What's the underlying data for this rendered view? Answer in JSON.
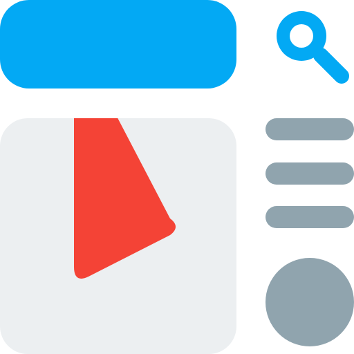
{
  "colors": {
    "accent_blue": "#03A9F4",
    "panel_bg": "#ECEFF1",
    "play_red": "#F44336",
    "gray": "#90A4AE",
    "white": "#FFFFFF"
  },
  "icons": {
    "search": "search-icon",
    "play": "play-icon",
    "list": "list-lines-icon",
    "avatar": "circle-avatar-icon"
  }
}
